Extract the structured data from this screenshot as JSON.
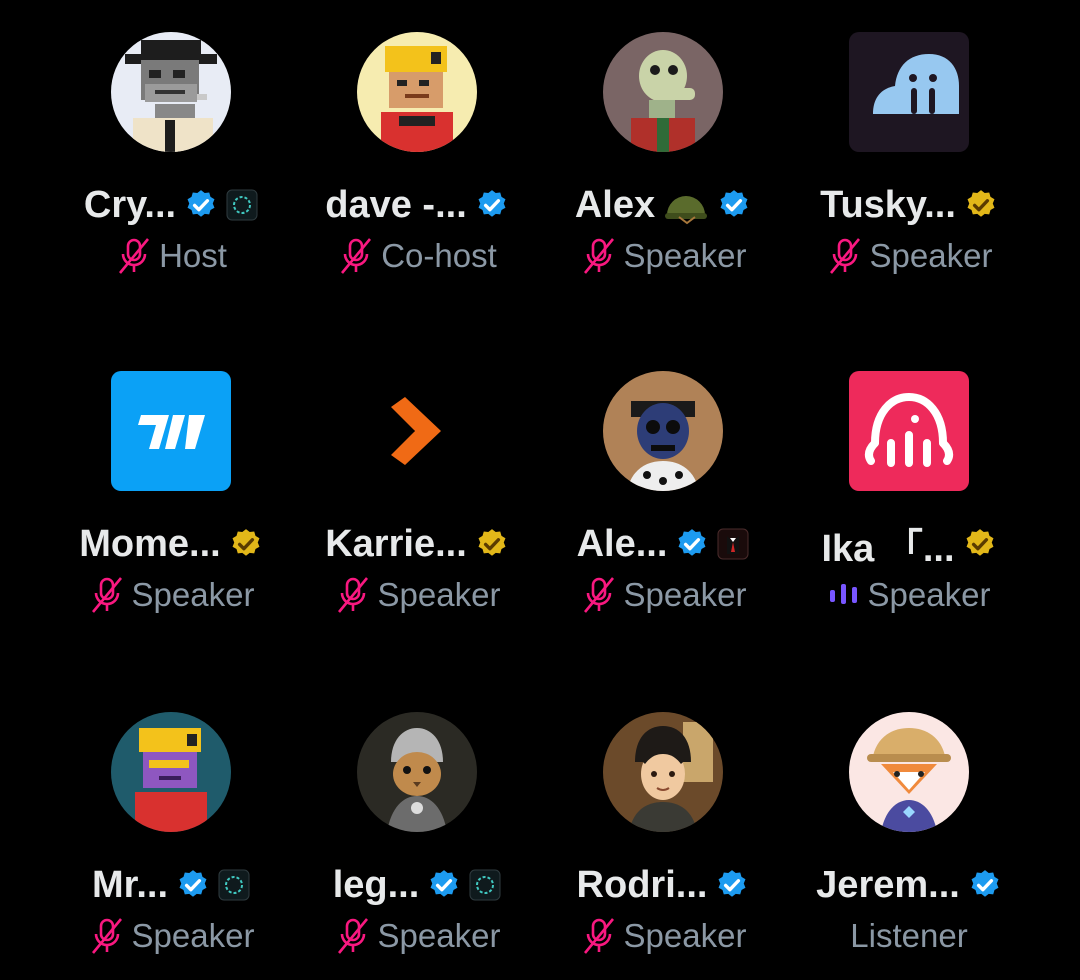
{
  "colors": {
    "verified_blue": "#1d9bf0",
    "verified_gold": "#e2b719",
    "muted_mic": "#f91880",
    "speaking": "#7856ff",
    "role_text": "#8b98a5"
  },
  "participants": [
    {
      "name": "Cry...",
      "role": "Host",
      "verified": "blue",
      "affiliate": true,
      "mic": "muted",
      "avatar": "pixel-cowboy"
    },
    {
      "name": "dave -...",
      "role": "Co-host",
      "verified": "blue",
      "affiliate": false,
      "mic": "muted",
      "avatar": "pixel-helmet-yellow"
    },
    {
      "name": "Alex",
      "role": "Speaker",
      "verified": "blue",
      "affiliate": false,
      "emoji": "military-helmet",
      "mic": "muted",
      "avatar": "lizard"
    },
    {
      "name": "Tusky...",
      "role": "Speaker",
      "verified": "gold",
      "affiliate": false,
      "mic": "muted",
      "avatar": "walrus-logo"
    },
    {
      "name": "Mome...",
      "role": "Speaker",
      "verified": "gold",
      "affiliate": false,
      "mic": "muted",
      "avatar": "momentum-logo"
    },
    {
      "name": "Karrie...",
      "role": "Speaker",
      "verified": "gold",
      "affiliate": false,
      "mic": "muted",
      "avatar": "karrier-logo"
    },
    {
      "name": "Ale...",
      "role": "Speaker",
      "verified": "blue",
      "affiliate": true,
      "affiliate_style": "suit",
      "mic": "muted",
      "avatar": "skull"
    },
    {
      "name": "Ika 「...",
      "role": "Speaker",
      "verified": "gold",
      "affiliate": false,
      "mic": "speaking",
      "avatar": "ika-logo"
    },
    {
      "name": "Mr...",
      "role": "Speaker",
      "verified": "blue",
      "affiliate": true,
      "mic": "muted",
      "avatar": "pixel-helmet-purple"
    },
    {
      "name": "leg...",
      "role": "Speaker",
      "verified": "blue",
      "affiliate": true,
      "mic": "muted",
      "avatar": "cat-knight"
    },
    {
      "name": "Rodri...",
      "role": "Speaker",
      "verified": "blue",
      "affiliate": false,
      "mic": "muted",
      "avatar": "anime-boy"
    },
    {
      "name": "Jerem...",
      "role": "Listener",
      "verified": "blue",
      "affiliate": false,
      "mic": "none",
      "avatar": "fox-hat"
    }
  ]
}
